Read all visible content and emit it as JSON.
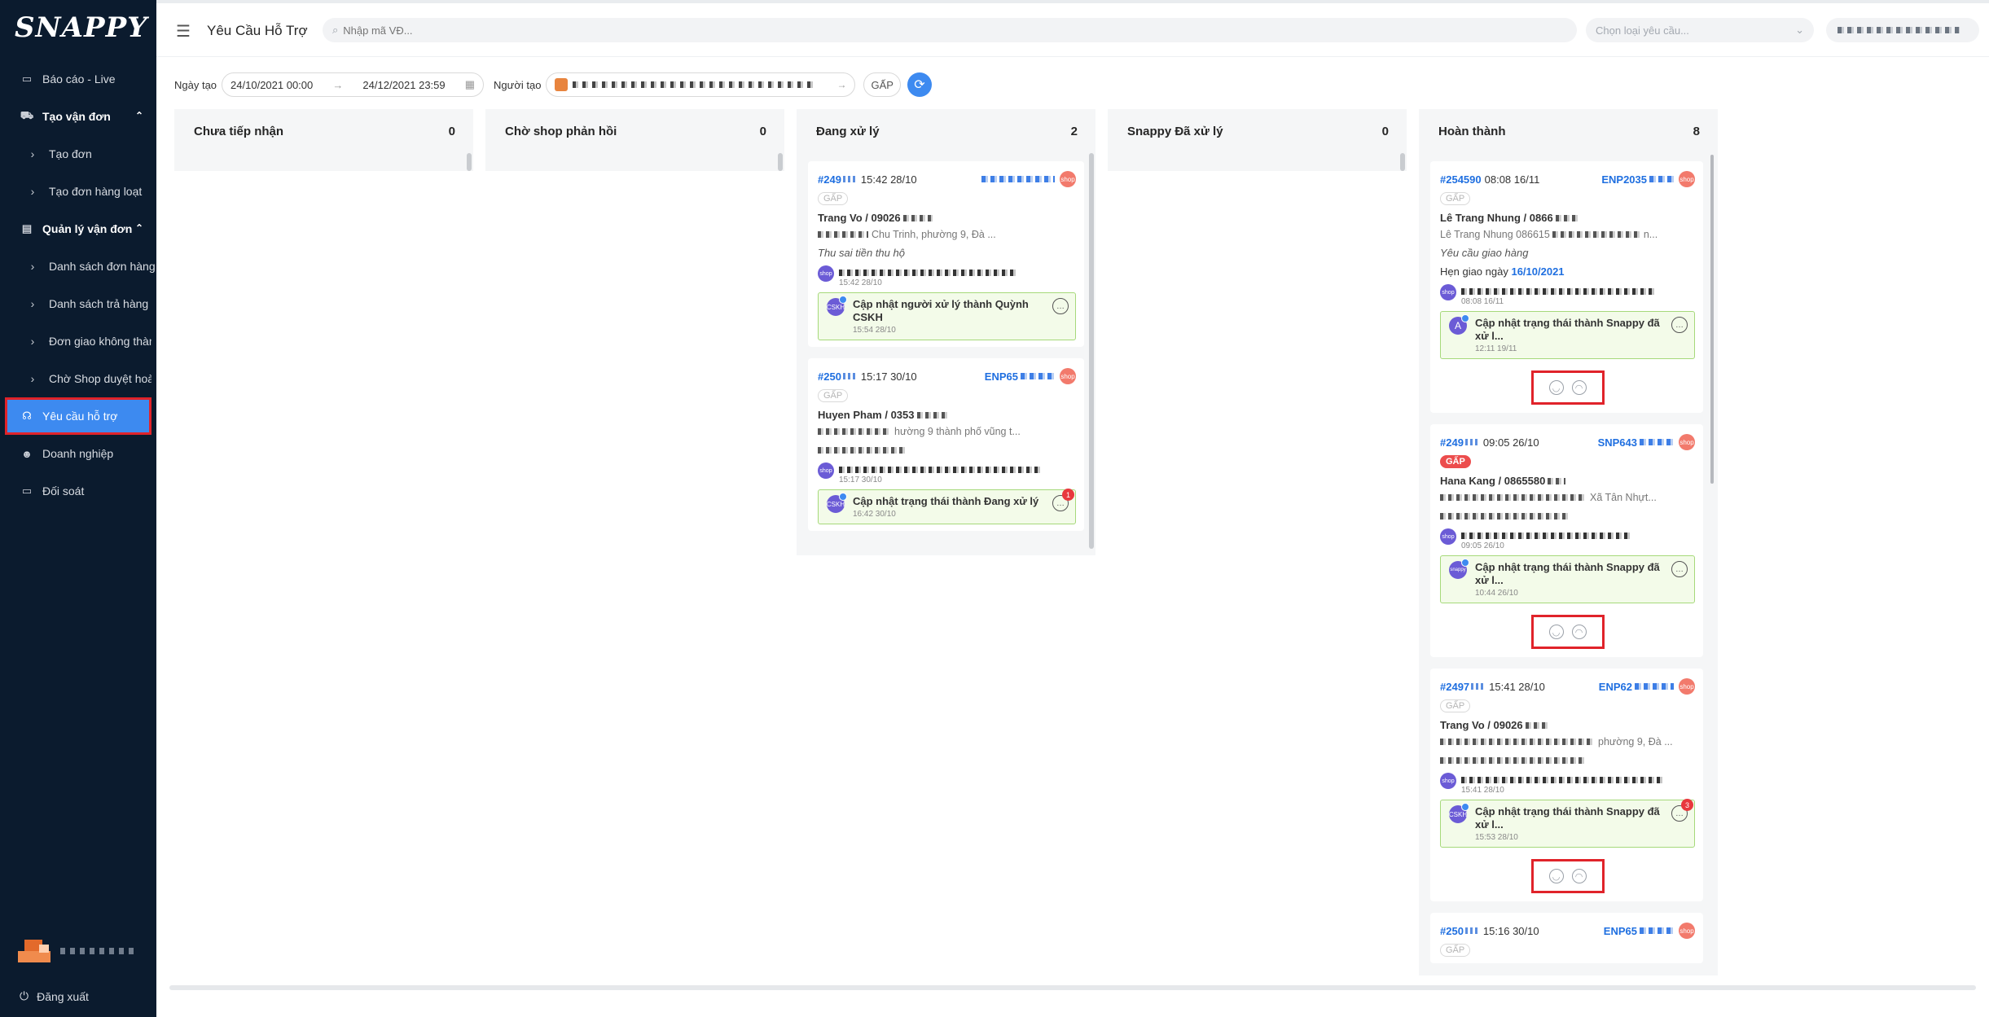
{
  "sidebar": {
    "logo": "SNAPPY",
    "items": [
      {
        "label": "Báo cáo - Live",
        "icon": "report-icon"
      },
      {
        "label": "Tạo vận đơn",
        "icon": "truck-icon"
      },
      {
        "label": "Tạo đơn",
        "icon": "chevron-right-icon"
      },
      {
        "label": "Tạo đơn hàng loạt",
        "icon": "chevron-right-icon"
      },
      {
        "label": "Quản lý vận đơn",
        "icon": "document-icon"
      },
      {
        "label": "Danh sách đơn hàng",
        "icon": "chevron-right-icon"
      },
      {
        "label": "Danh sách trả hàng",
        "icon": "chevron-right-icon"
      },
      {
        "label": "Đơn giao không thành",
        "icon": "chevron-right-icon"
      },
      {
        "label": "Chờ Shop duyệt hoàn",
        "icon": "chevron-right-icon"
      },
      {
        "label": "Yêu cầu hỗ trợ",
        "icon": "headset-icon"
      },
      {
        "label": "Doanh nghiệp",
        "icon": "users-icon"
      },
      {
        "label": "Đối soát",
        "icon": "card-icon"
      }
    ],
    "logout": "Đăng xuất"
  },
  "header": {
    "title": "Yêu Cầu Hỗ Trợ",
    "search_placeholder": "Nhập mã VĐ...",
    "type_placeholder": "Chọn loại yêu cầu..."
  },
  "filter": {
    "date_label": "Ngày tạo",
    "date_from": "24/10/2021 00:00",
    "date_to": "24/12/2021 23:59",
    "creator_label": "Người tạo",
    "urgent_label": "GẤP"
  },
  "columns": [
    {
      "title": "Chưa tiếp nhận",
      "count": "0"
    },
    {
      "title": "Chờ shop phản hồi",
      "count": "0"
    },
    {
      "title": "Đang xử lý",
      "count": "2"
    },
    {
      "title": "Snappy Đã xử lý",
      "count": "0"
    },
    {
      "title": "Hoàn thành",
      "count": "8"
    }
  ],
  "processing_cards": [
    {
      "id": "#249",
      "time": "15:42 28/10",
      "order": "",
      "tag": "GẤP",
      "customer": "Trang Vo / 09026",
      "address": "Chu Trinh, phường 9, Đà ...",
      "reason": "Thu sai tiền thu hộ",
      "shop_label": "shop",
      "msg_time": "15:42 28/10",
      "update_title": "Cập nhật người xử lý thành Quỳnh CSKH",
      "update_time": "15:54 28/10",
      "update_avatar": "CSKH",
      "unread": ""
    },
    {
      "id": "#250",
      "time": "15:17 30/10",
      "order": "ENP65",
      "tag": "GẤP",
      "customer": "Huyen Pham / 0353",
      "address": "hường 9 thành phố vũng t...",
      "reason": "",
      "shop_label": "shop",
      "msg_time": "15:17 30/10",
      "update_title": "Cập nhật trạng thái thành Đang xử lý",
      "update_time": "16:42 30/10",
      "update_avatar": "CSKH",
      "unread": "1"
    }
  ],
  "completed_cards": [
    {
      "id": "#254590",
      "time": "08:08 16/11",
      "order": "ENP2035",
      "tag": "GẤP",
      "customer": "Lê Trang Nhung / 0866",
      "address": "Lê Trang Nhung 086615",
      "reason": "Yêu cầu giao hàng",
      "hen_label": "Hẹn giao ngày",
      "hen_date": "16/10/2021",
      "shop_label": "shop",
      "msg_time": "08:08 16/11",
      "update_title": "Cập nhật trạng thái thành Snappy đã xử l...",
      "update_time": "12:11 19/11",
      "update_avatar": "A",
      "unread": ""
    },
    {
      "id": "#249",
      "time": "09:05 26/10",
      "order": "SNP643",
      "tag": "GẤP",
      "customer": "Hana Kang / 0865580",
      "address": "Xã Tân Nhựt...",
      "reason": "",
      "hen_label": "",
      "hen_date": "",
      "shop_label": "shop",
      "msg_time": "09:05 26/10",
      "update_title": "Cập nhật trạng thái thành Snappy đã xử l...",
      "update_time": "10:44 26/10",
      "update_avatar": "snappy",
      "unread": ""
    },
    {
      "id": "#2497",
      "time": "15:41 28/10",
      "order": "ENP62",
      "tag": "GẤP",
      "customer": "Trang Vo / 09026",
      "address": "phường 9, Đà ...",
      "reason": "",
      "hen_label": "",
      "hen_date": "",
      "shop_label": "shop",
      "msg_time": "15:41 28/10",
      "update_title": "Cập nhật trạng thái thành Snappy đã xử l...",
      "update_time": "15:53 28/10",
      "update_avatar": "CSKH",
      "unread": "3"
    },
    {
      "id": "#250",
      "time": "15:16 30/10",
      "order": "ENP65",
      "tag": "GẤP"
    }
  ],
  "colors": {
    "sidebar_bg": "#0b1b2e",
    "accent": "#3d8af0",
    "urgent": "#ec4d4d",
    "highlight": "#e0232a",
    "update_bg": "#f3fbe9"
  }
}
